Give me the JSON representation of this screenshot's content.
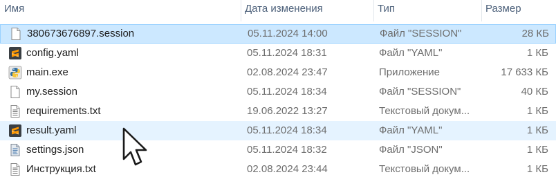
{
  "columns": {
    "name": "Имя",
    "date": "Дата изменения",
    "type": "Тип",
    "size": "Размер"
  },
  "files": [
    {
      "name": "380673676897.session",
      "date": "05.11.2024 14:00",
      "type": "Файл \"SESSION\"",
      "size": "28 КБ",
      "icon": "blank-document-icon",
      "state": "selected"
    },
    {
      "name": "config.yaml",
      "date": "05.11.2024 18:31",
      "type": "Файл \"YAML\"",
      "size": "1 КБ",
      "icon": "sublime-text-icon",
      "state": "normal"
    },
    {
      "name": "main.exe",
      "date": "02.08.2024 23:47",
      "type": "Приложение",
      "size": "17 633 КБ",
      "icon": "python-executable-icon",
      "state": "normal"
    },
    {
      "name": "my.session",
      "date": "05.11.2024 18:34",
      "type": "Файл \"SESSION\"",
      "size": "40 КБ",
      "icon": "blank-document-icon",
      "state": "normal"
    },
    {
      "name": "requirements.txt",
      "date": "19.06.2022 13:27",
      "type": "Текстовый докум...",
      "size": "1 КБ",
      "icon": "text-document-icon",
      "state": "normal"
    },
    {
      "name": "result.yaml",
      "date": "05.11.2024 18:34",
      "type": "Файл \"YAML\"",
      "size": "1 КБ",
      "icon": "sublime-text-icon",
      "state": "hovered"
    },
    {
      "name": "settings.json",
      "date": "05.11.2024 18:32",
      "type": "Файл \"JSON\"",
      "size": "1 КБ",
      "icon": "json-document-icon",
      "state": "normal"
    },
    {
      "name": "Инструкция.txt",
      "date": "02.08.2024 23:44",
      "type": "Текстовый докум...",
      "size": "1 КБ",
      "icon": "text-document-icon",
      "state": "normal"
    }
  ],
  "colors": {
    "selection_bg": "#cce8ff",
    "selection_border": "#99d1ff",
    "hover_bg": "#e5f3ff",
    "header_text": "#4c607a"
  }
}
